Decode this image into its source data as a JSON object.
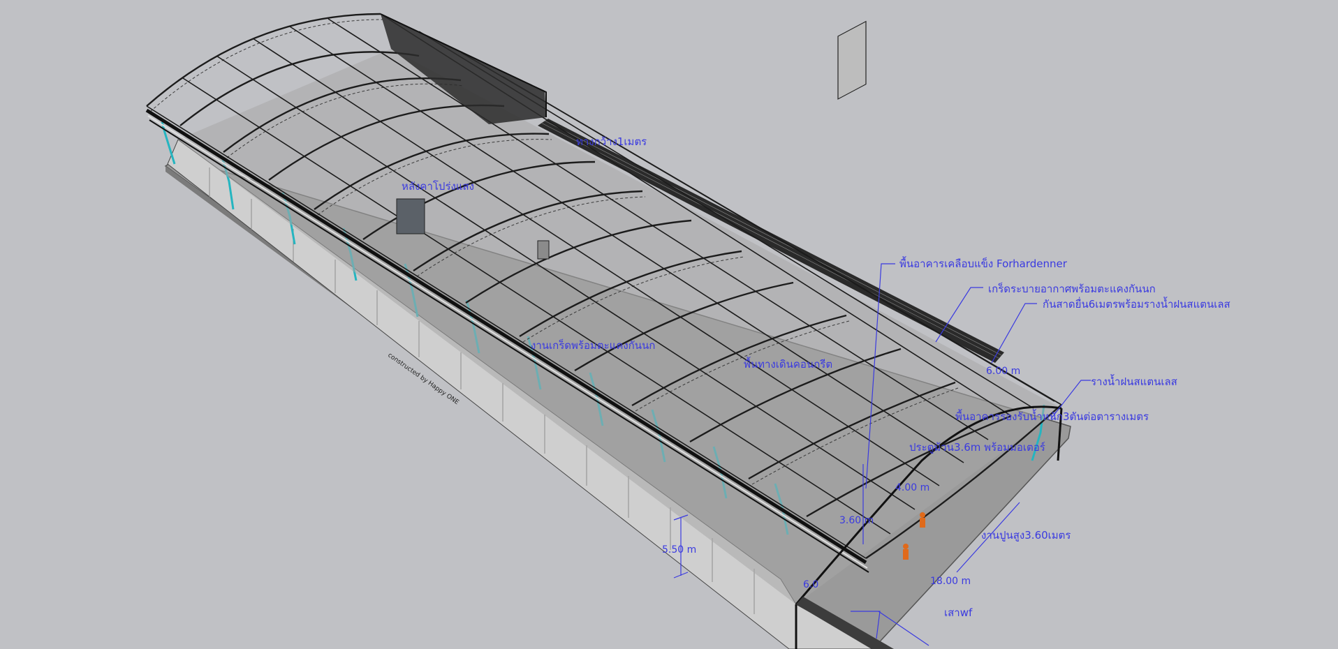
{
  "colors": {
    "background": "#c0c1c5",
    "annotation": "#3a3ae0",
    "steel": "#1c1c1c",
    "gutter": "#25b5c0",
    "slab": "#9a9a9a"
  },
  "labels": {
    "hardener_floor": "พื้นอาคารเคลือบแข็ง Forhardenner",
    "vent_grille": "เกร็ดระบายอากาศพร้อมตะแคงกันนก",
    "canopy": "กันสาดยื่น6เมตรพร้อมรางน้ำฝนสแตนเลส",
    "stainless_gutter": "รางน้ำฝนสแตนเลส",
    "floor_load": "พื้นอาคารรองรับน้ำหนัก3ตันต่อตารางเมตร",
    "roll_door": "ประตูม้วน3.6m พร้อมมอเตอร์",
    "brick_wall": "งานปูนสูง3.60เมตร",
    "wf_column": "เสาwf",
    "walkway": "ทางกว้าง1เมตร",
    "skylight": "หลังคาโปร่งแสง",
    "vent_door": "งานเกร็ดพร้อมตะแคงกันนก",
    "walk_floor": "พื้นทางเดินคอนกรีต",
    "wall_stamp": "constructed by Happy ONE"
  },
  "dimensions": {
    "eave_height": "5.50 m",
    "span": "18.00 m",
    "door_height": "3.60 m",
    "door_width": "4.00 m",
    "canopy_width": "6.00 m",
    "column_bay": "6.0"
  }
}
